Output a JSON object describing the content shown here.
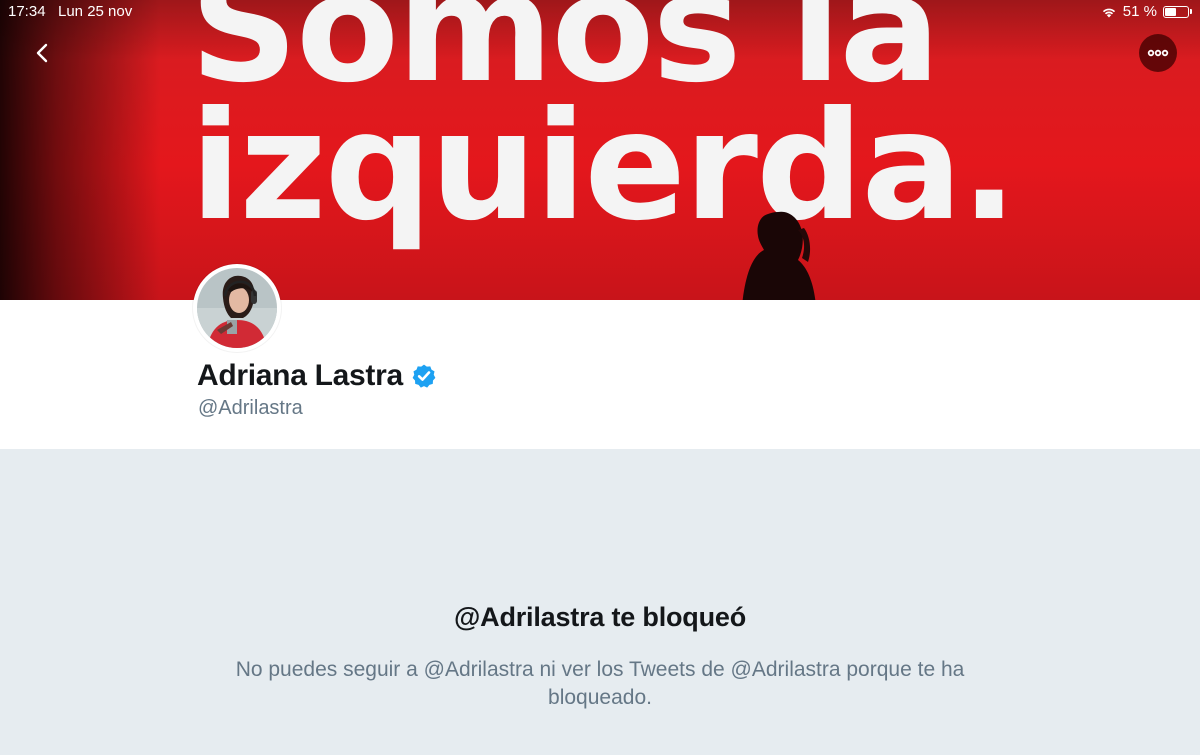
{
  "status_bar": {
    "time": "17:34",
    "date": "Lun 25 nov",
    "battery": "51 %",
    "battery_level": 0.51
  },
  "banner": {
    "slogan": "Somos la\nizquierda.",
    "background_color": "#e4171c"
  },
  "profile": {
    "name": "Adriana Lastra",
    "handle": "@Adrilastra",
    "verified": true,
    "verified_color": "#1da1f2"
  },
  "blocked": {
    "title": "@Adrilastra te bloqueó",
    "message": "No puedes seguir a @Adrilastra ni ver los Tweets de @Adrilastra porque te ha bloqueado."
  },
  "icons": {
    "back": "chevron-left-icon",
    "more": "more-horizontal-icon",
    "verified": "verified-badge-icon",
    "wifi": "wifi-icon",
    "battery": "battery-icon"
  },
  "colors": {
    "text_primary": "#14171a",
    "text_secondary": "#657786",
    "page_background": "#e6ecf0"
  }
}
